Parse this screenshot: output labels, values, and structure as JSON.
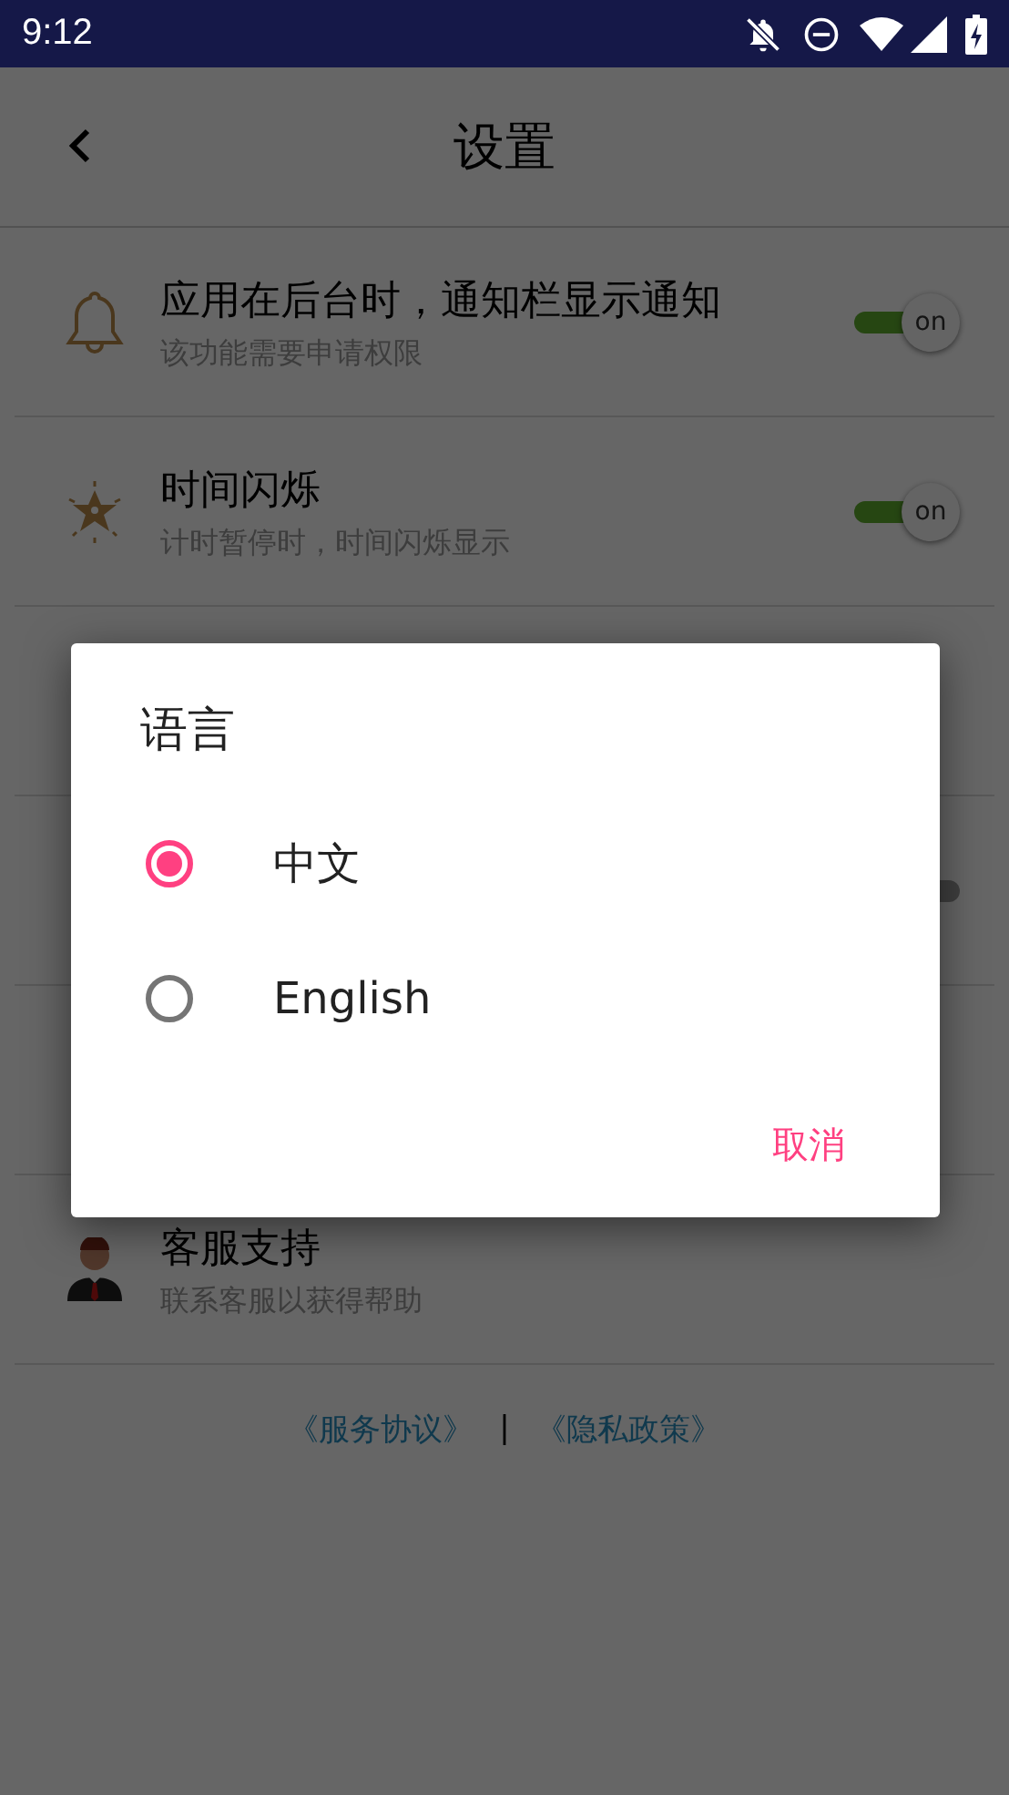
{
  "status_bar": {
    "time": "9:12"
  },
  "app_bar": {
    "title": "设置"
  },
  "settings": [
    {
      "kind": "item",
      "title": "应用在后台时，通知栏显示通知",
      "subtitle": "该功能需要申请权限",
      "toggle": {
        "on": true,
        "label": "on"
      }
    },
    {
      "kind": "item",
      "title": "时间闪烁",
      "subtitle": "计时暂停时，时间闪烁显示",
      "toggle": {
        "on": true,
        "label": "on"
      }
    },
    {
      "kind": "covered"
    },
    {
      "kind": "covered",
      "toggle": {
        "on": false
      }
    },
    {
      "kind": "covered"
    },
    {
      "kind": "item",
      "title": "客服支持",
      "subtitle": "联系客服以获得帮助"
    }
  ],
  "footer": {
    "links": [
      "《服务协议》",
      "《隐私政策》"
    ],
    "separator": "|"
  },
  "dialog": {
    "title": "语言",
    "options": [
      {
        "label": "中文",
        "selected": true
      },
      {
        "label": "English",
        "selected": false
      }
    ],
    "cancel": "取消"
  }
}
